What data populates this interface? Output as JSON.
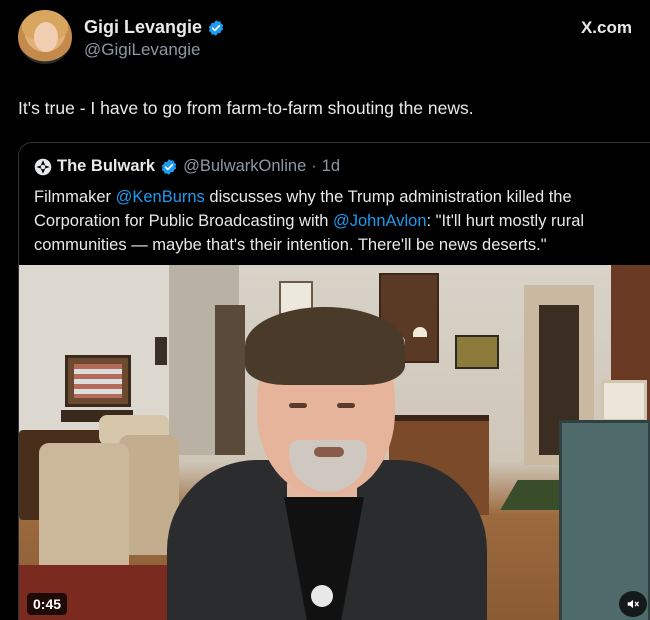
{
  "post": {
    "author_name": "Gigi Levangie",
    "author_handle": "@GigiLevangie",
    "site": "X.com",
    "text": "It's true - I have to go from farm-to-farm shouting the news."
  },
  "quoted": {
    "author_name": "The Bulwark",
    "author_handle": "@BulwarkOnline",
    "separator": "·",
    "age": "1d",
    "text_1": "Filmmaker ",
    "mention_1": "@KenBurns",
    "text_2": " discusses why the Trump administration killed the Corporation for Public Broadcasting with ",
    "mention_2": "@JohnAvlon",
    "text_3": ": \"It'll hurt mostly rural communities — maybe that's their intention. There'll be news deserts.\""
  },
  "video": {
    "timestamp": "0:45",
    "mute_icon": "speaker-muted-icon"
  },
  "colors": {
    "background": "#000000",
    "text": "#e7e9ea",
    "secondary_text": "#8b98a5",
    "link": "#1d9bf0",
    "verified": "#1d9bf0"
  }
}
